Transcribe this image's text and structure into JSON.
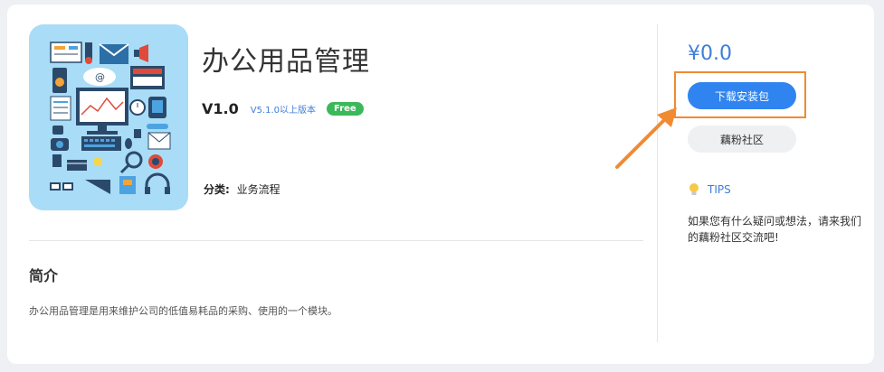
{
  "app": {
    "title": "办公用品管理",
    "version": "V1.0",
    "compat": "V5.1.0以上版本",
    "badge": "Free",
    "category_label": "分类:",
    "category_value": "业务流程",
    "icon": "office-supplies-collage-icon"
  },
  "intro": {
    "title": "简介",
    "text": "办公用品管理是用来维护公司的低值易耗品的采购、使用的一个模块。"
  },
  "sidebar": {
    "price": "¥0.0",
    "download_label": "下载安装包",
    "community_label": "藕粉社区",
    "tips_label": "TIPS",
    "tips_text": "如果您有什么疑问或想法，请来我们的藕粉社区交流吧!"
  },
  "colors": {
    "accent": "#2f84f0",
    "link": "#3f7fd8",
    "free": "#3bb85a",
    "highlight": "#f08b31",
    "icon_bg": "#a9dcf6"
  }
}
